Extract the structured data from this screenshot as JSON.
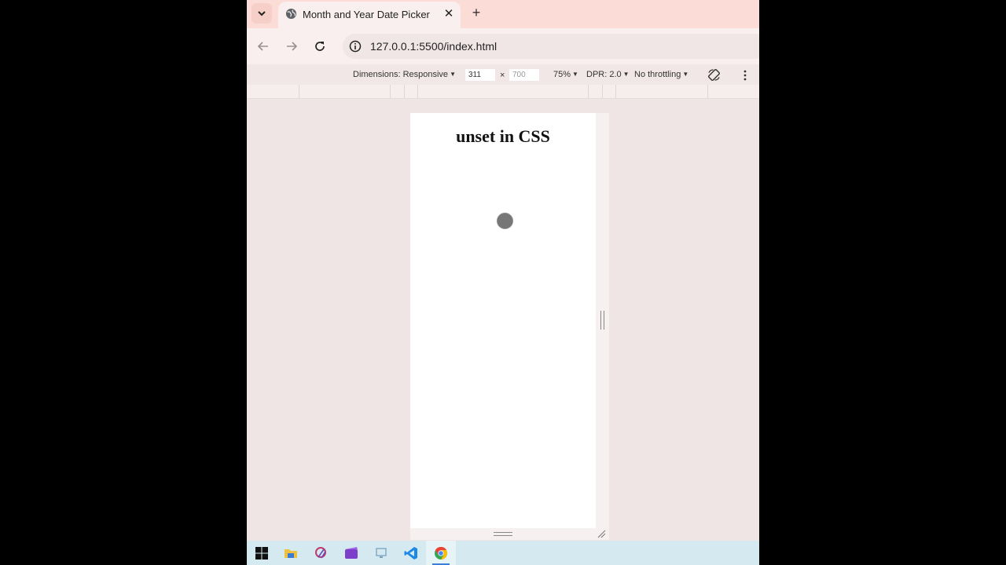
{
  "browser": {
    "tab_title": "Month and Year Date Picker",
    "url": "127.0.0.1:5500/index.html"
  },
  "devtools": {
    "dimensions_label": "Dimensions: Responsive",
    "width": "311",
    "times": "×",
    "height": "700",
    "zoom": "75%",
    "dpr": "DPR: 2.0",
    "throttling": "No throttling"
  },
  "page": {
    "heading": "unset in CSS"
  },
  "icons": {
    "tab_search": "chevron-down-icon",
    "tab_favicon": "globe-icon",
    "tab_close": "close-icon",
    "new_tab": "plus-icon",
    "back": "arrow-left-icon",
    "forward": "arrow-right-icon",
    "reload": "reload-icon",
    "site_info": "info-icon",
    "rotate": "rotate-icon",
    "more": "kebab-icon"
  },
  "taskbar": {
    "apps": [
      "windows-start-icon",
      "file-explorer-icon",
      "snipping-tool-icon",
      "clipchamp-icon",
      "remote-desktop-icon",
      "vscode-icon",
      "chrome-icon"
    ]
  },
  "colors": {
    "tabstrip": "#fbdcd7",
    "toolbar": "#f8efee",
    "taskbar": "#d4eaf0"
  }
}
